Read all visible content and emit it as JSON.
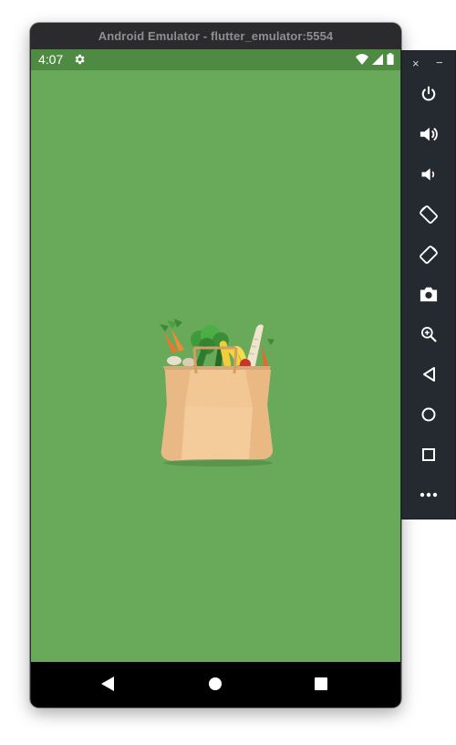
{
  "window": {
    "title": "Android Emulator - flutter_emulator:5554"
  },
  "status_bar": {
    "time": "4:07"
  },
  "app": {
    "background_color": "#69a95a",
    "status_bar_color": "#4e8a42",
    "splash_image": "grocery-bag-illustration"
  },
  "nav_bar": {
    "buttons": [
      "back",
      "home",
      "recents"
    ]
  },
  "toolbar": {
    "close_label": "×",
    "minimize_label": "−",
    "buttons": [
      "power-icon",
      "volume-up-icon",
      "volume-down-icon",
      "rotate-left-icon",
      "rotate-right-icon",
      "camera-icon",
      "zoom-icon",
      "back-icon",
      "home-icon",
      "overview-icon",
      "more-icon"
    ]
  }
}
